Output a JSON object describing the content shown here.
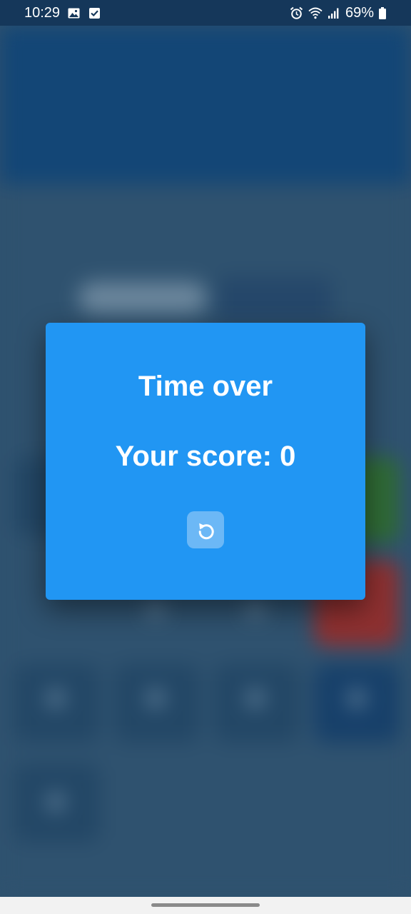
{
  "status_bar": {
    "time": "10:29",
    "battery": "69%",
    "left_icons": [
      "image-icon",
      "checkbox-icon"
    ],
    "right_icons": [
      "alarm-icon",
      "wifi-icon",
      "signal-icon",
      "battery-icon"
    ]
  },
  "dialog": {
    "title": "Time over",
    "score_text": "Your score: 0",
    "replay_icon": "replay-icon"
  },
  "colors": {
    "dialog_background": "#2196f3",
    "replay_button": "#6cb8f6",
    "background_header": "#134676",
    "background_body": "#2f526f"
  }
}
